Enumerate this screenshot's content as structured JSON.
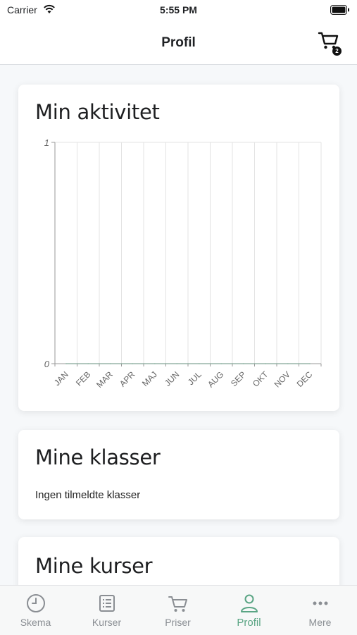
{
  "status": {
    "carrier": "Carrier",
    "time": "5:55 PM"
  },
  "nav": {
    "title": "Profil",
    "cart_badge": "2"
  },
  "activity": {
    "title": "Min aktivitet",
    "chart_data": {
      "type": "line",
      "categories": [
        "JAN",
        "FEB",
        "MAR",
        "APR",
        "MAJ",
        "JUN",
        "JUL",
        "AUG",
        "SEP",
        "OKT",
        "NOV",
        "DEC"
      ],
      "series": [
        {
          "values": [
            0,
            0,
            0,
            0,
            0,
            0,
            0,
            0,
            0,
            0,
            0,
            0
          ]
        }
      ],
      "ylim": [
        0,
        1
      ],
      "yticks": [
        "0",
        "1"
      ],
      "grid": true
    }
  },
  "classes": {
    "title": "Mine klasser",
    "empty_text": "Ingen tilmeldte klasser"
  },
  "courses": {
    "title": "Mine kurser"
  },
  "tabs": [
    {
      "label": "Skema",
      "icon": "clock-icon"
    },
    {
      "label": "Kurser",
      "icon": "list-icon"
    },
    {
      "label": "Priser",
      "icon": "cart-icon"
    },
    {
      "label": "Profil",
      "icon": "user-icon"
    },
    {
      "label": "Mere",
      "icon": "more-icon"
    }
  ],
  "colors": {
    "accent": "#5aa584",
    "inactive": "#8a8e93"
  }
}
